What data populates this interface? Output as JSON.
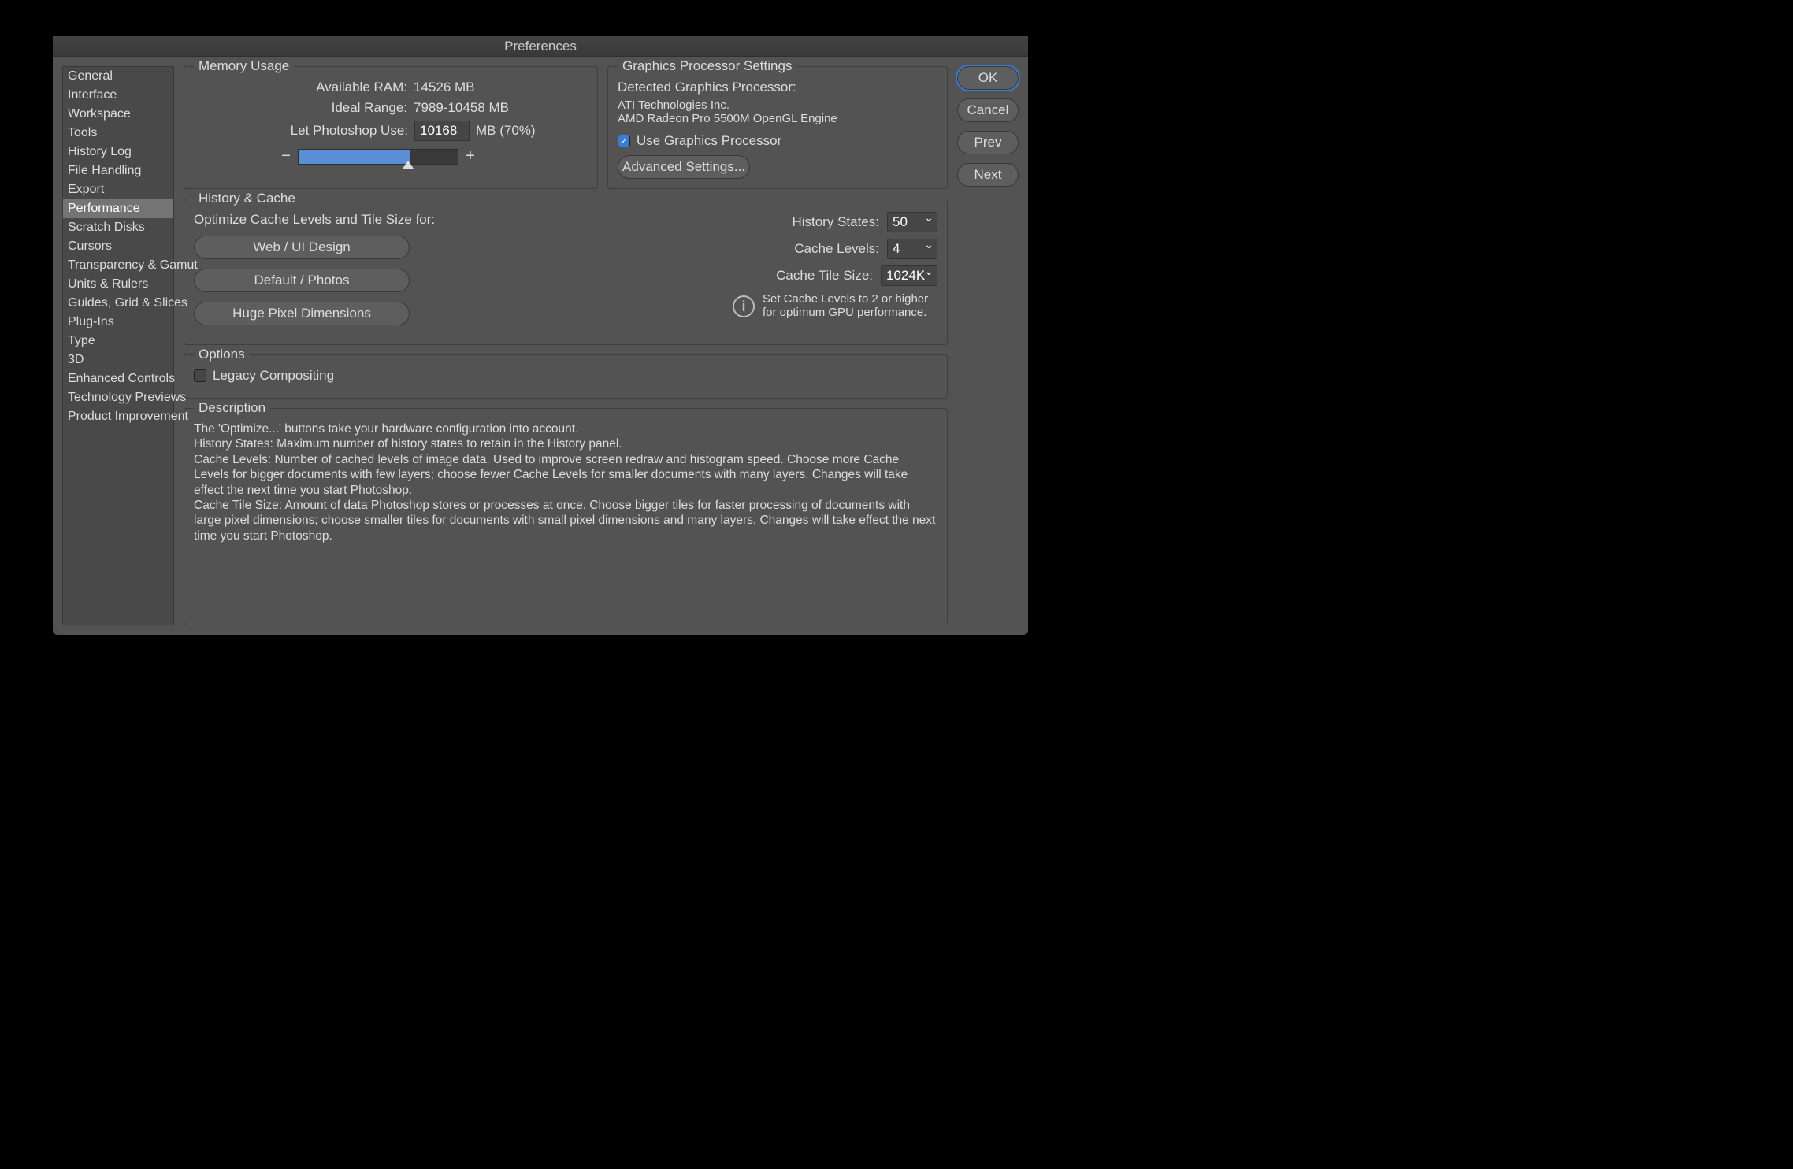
{
  "title": "Preferences",
  "sidebar": {
    "items": [
      {
        "label": "General"
      },
      {
        "label": "Interface"
      },
      {
        "label": "Workspace"
      },
      {
        "label": "Tools"
      },
      {
        "label": "History Log"
      },
      {
        "label": "File Handling"
      },
      {
        "label": "Export"
      },
      {
        "label": "Performance"
      },
      {
        "label": "Scratch Disks"
      },
      {
        "label": "Cursors"
      },
      {
        "label": "Transparency & Gamut"
      },
      {
        "label": "Units & Rulers"
      },
      {
        "label": "Guides, Grid & Slices"
      },
      {
        "label": "Plug-Ins"
      },
      {
        "label": "Type"
      },
      {
        "label": "3D"
      },
      {
        "label": "Enhanced Controls"
      },
      {
        "label": "Technology Previews"
      },
      {
        "label": "Product Improvement"
      }
    ]
  },
  "actions": {
    "ok": "OK",
    "cancel": "Cancel",
    "prev": "Prev",
    "next": "Next"
  },
  "memory": {
    "legend": "Memory Usage",
    "available_label": "Available RAM:",
    "available_value": "14526 MB",
    "ideal_label": "Ideal Range:",
    "ideal_value": "7989-10458 MB",
    "let_label": "Let Photoshop Use:",
    "let_value": "10168",
    "let_suffix": "MB (70%)"
  },
  "gpu": {
    "legend": "Graphics Processor Settings",
    "detected_label": "Detected Graphics Processor:",
    "vendor": "ATI Technologies Inc.",
    "model": "AMD Radeon Pro 5500M OpenGL Engine",
    "use_label": "Use Graphics Processor",
    "advanced": "Advanced Settings..."
  },
  "history": {
    "legend": "History & Cache",
    "optimize_label": "Optimize Cache Levels and Tile Size for:",
    "presets": [
      {
        "label": "Web / UI Design"
      },
      {
        "label": "Default / Photos"
      },
      {
        "label": "Huge Pixel Dimensions"
      }
    ],
    "states_label": "History States:",
    "states_value": "50",
    "levels_label": "Cache Levels:",
    "levels_value": "4",
    "tile_label": "Cache Tile Size:",
    "tile_value": "1024K",
    "hint": "Set Cache Levels to 2 or higher for optimum GPU performance."
  },
  "options": {
    "legend": "Options",
    "legacy_label": "Legacy Compositing"
  },
  "description": {
    "legend": "Description",
    "l1": "The 'Optimize...' buttons take your hardware configuration into account.",
    "l2": "History States: Maximum number of history states to retain in the History panel.",
    "l3": "Cache Levels: Number of cached levels of image data.  Used to improve screen redraw and histogram speed.  Choose more Cache Levels for bigger documents with few layers; choose fewer Cache Levels for smaller documents with many layers. Changes will take effect the next time you start Photoshop.",
    "l4": "Cache Tile Size: Amount of data Photoshop stores or processes at once. Choose bigger tiles for faster processing of documents with large pixel dimensions; choose smaller tiles for documents with small pixel dimensions and many layers. Changes will take effect the next time you start Photoshop."
  }
}
